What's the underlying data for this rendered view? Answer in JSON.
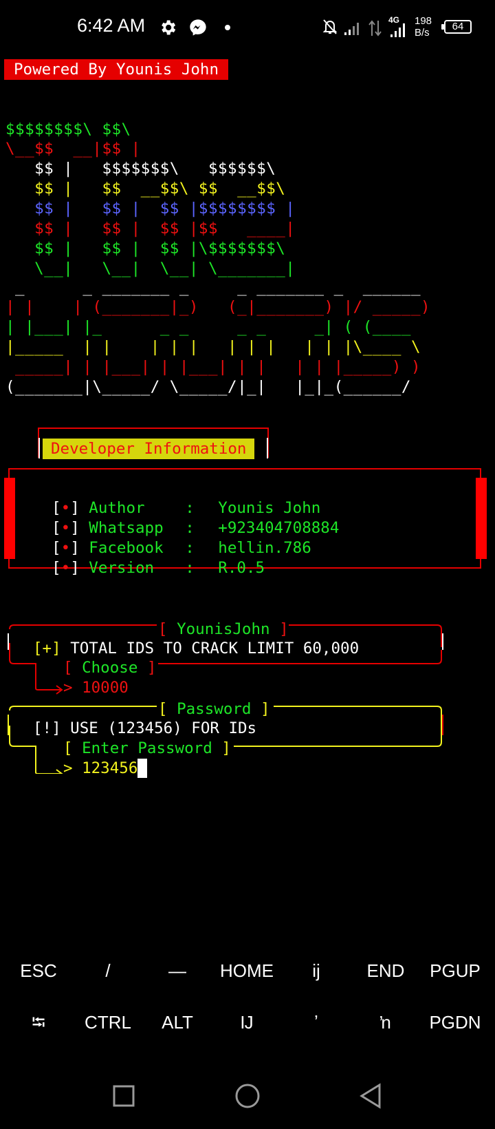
{
  "status_bar": {
    "time": "6:42 AM",
    "network_type": "4G",
    "speed_value": "198",
    "speed_unit": "B/s",
    "battery": "64"
  },
  "banner": {
    "label": "Powered By Younis John"
  },
  "logo": {
    "line1": "$$$$$$$$\\ $$\\",
    "line2": "\\__$$  __|$$ |",
    "line3": "   $$ |   $$$$$$$\\   $$$$$$\\",
    "line4": "   $$ |   $$  __$$\\ $$  __$$\\",
    "line5": "   $$ |   $$ |  $$ |$$$$$$$$ |",
    "line6": "   $$ |   $$ |  $$ |$$   ____|",
    "line7": "   $$ |   $$ |  $$ |\\$$$$$$$\\",
    "line8": "   \\__|   \\__|  \\__| \\_______|",
    "line9": " _      _ _______ _     _ _______ _  ______",
    "line10": "| |    | (_______|_)   (_|_______) |/ _____)",
    "line11": "| |___| |_      _ _     _ _     _| ( (____",
    "line12": "|_____  | |    | | |   | | |   | | |\\____ \\",
    "line13": " _____| | |___| | |___| | |   | | |_____) )",
    "line14": "(_______|\\_____/ \\_____/|_|   |_|_(______/"
  },
  "developer": {
    "title": "Developer Information",
    "rows": [
      {
        "bullet": "[•]",
        "key": "Author",
        "sep": ":",
        "value": "Younis John"
      },
      {
        "bullet": "[•]",
        "key": "Whatsapp",
        "sep": ":",
        "value": "+923404708884"
      },
      {
        "bullet": "[•]",
        "key": "Facebook",
        "sep": ":",
        "value": "hellin.786"
      },
      {
        "bullet": "[•]",
        "key": "Version",
        "sep": ":",
        "value": "R.0.5"
      }
    ]
  },
  "crack_box": {
    "title": "[ YounisJohn ]",
    "marker": "[+]",
    "text": "TOTAL IDS TO CRACK LIMIT 60,000",
    "choose_label": "[ Choose ]",
    "choose_value": "10000"
  },
  "password_box": {
    "title": "[ Password ]",
    "text": "[!] USE (123456) FOR IDs",
    "prompt_label": "[ Enter Password ]",
    "input_value": "123456"
  },
  "extra_keys": {
    "row1": [
      "ESC",
      "/",
      "—",
      "HOME",
      "ĳ",
      "END",
      "PGUP"
    ],
    "row2": [
      "⭾",
      "CTRL",
      "ALT",
      "Ĳ",
      "ʼ",
      "ŉ",
      "PGDN"
    ]
  }
}
